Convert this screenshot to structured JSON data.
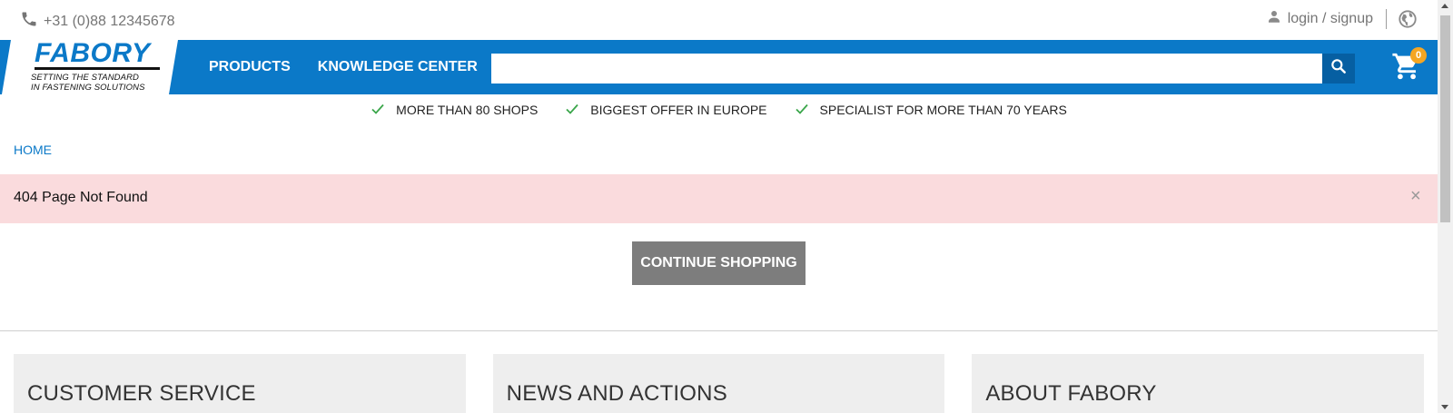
{
  "topbar": {
    "phone_icon": "phone-icon",
    "phone": "+31 (0)88 12345678",
    "user_icon": "user-icon",
    "login_label": "login / signup",
    "globe_icon": "globe-icon"
  },
  "header": {
    "logo": {
      "name": "FABORY",
      "tagline_1": "SETTING THE STANDARD",
      "tagline_2": "IN FASTENING SOLUTIONS"
    },
    "nav": [
      {
        "label": "PRODUCTS"
      },
      {
        "label": "KNOWLEDGE CENTER"
      }
    ],
    "search": {
      "value": "",
      "placeholder": "",
      "icon": "search-icon"
    },
    "cart": {
      "icon": "cart-icon",
      "count": "0"
    },
    "brand_color": "#0b79c8"
  },
  "usps": [
    {
      "icon": "check-icon",
      "label": "MORE THAN 80 SHOPS"
    },
    {
      "icon": "check-icon",
      "label": "BIGGEST OFFER IN EUROPE"
    },
    {
      "icon": "check-icon",
      "label": "SPECIALIST FOR MORE THAN 70 YEARS"
    }
  ],
  "breadcrumb": {
    "home": "HOME"
  },
  "alert": {
    "message": "404 Page Not Found",
    "close_symbol": "×",
    "background": "#fadbdd"
  },
  "main": {
    "continue_label": "CONTINUE SHOPPING"
  },
  "footer": {
    "cards": [
      {
        "title": "CUSTOMER SERVICE"
      },
      {
        "title": "NEWS AND ACTIONS"
      },
      {
        "title": "ABOUT FABORY"
      }
    ]
  }
}
